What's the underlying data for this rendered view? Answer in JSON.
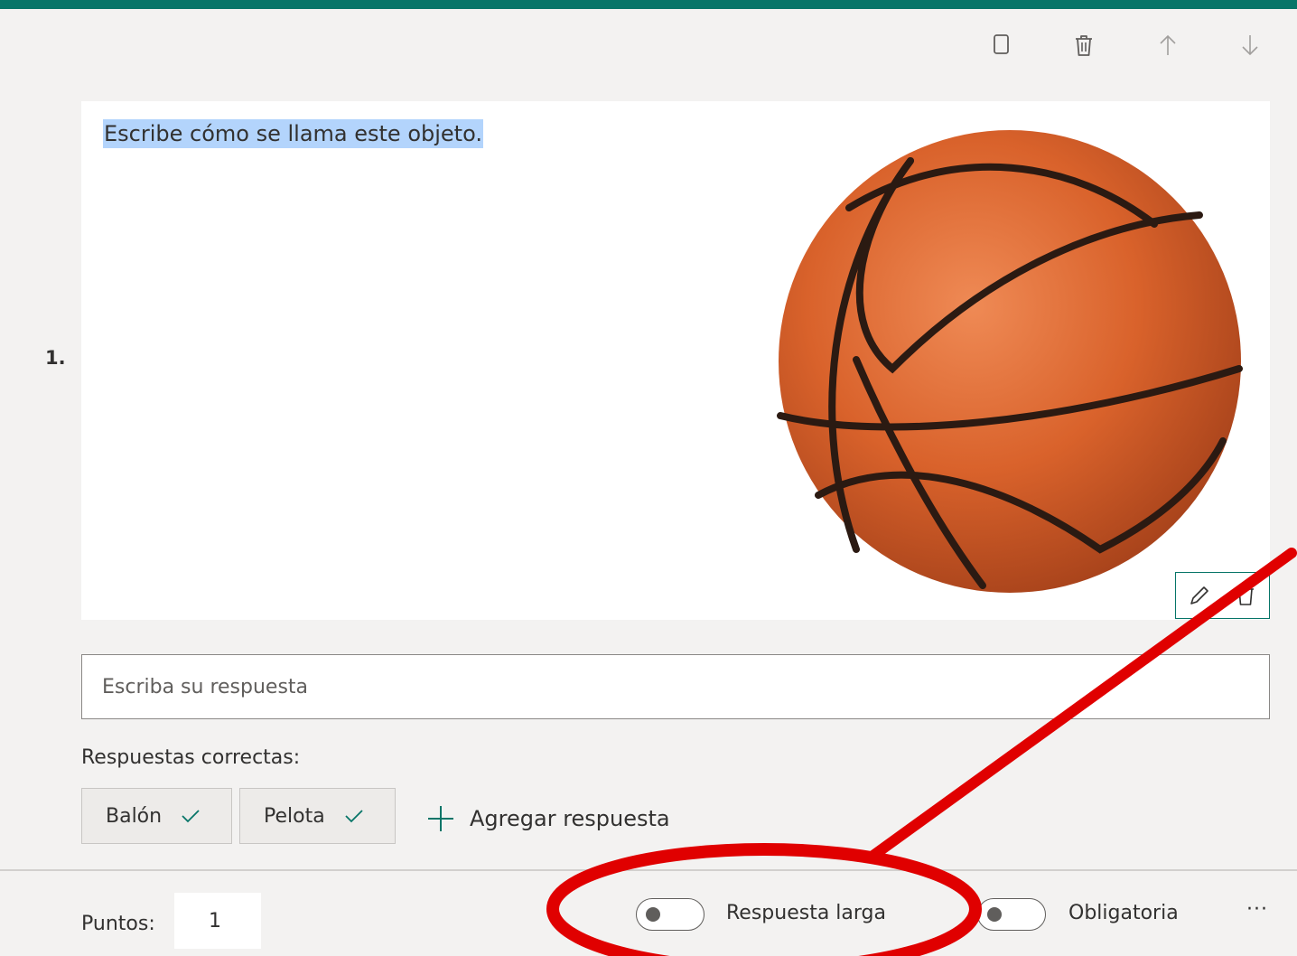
{
  "question": {
    "number": "1.",
    "text": "Escribe cómo se llama este objeto."
  },
  "toolbar": {
    "icons": [
      "copy-icon",
      "delete-icon",
      "move-up-icon",
      "move-down-icon"
    ]
  },
  "image_actions": {
    "icons": [
      "edit-icon",
      "delete-image-icon"
    ]
  },
  "answer": {
    "placeholder": "Escriba su respuesta"
  },
  "correct_answers": {
    "label": "Respuestas correctas:",
    "items": [
      "Balón",
      "Pelota"
    ],
    "add_label": "Agregar respuesta"
  },
  "footer": {
    "points_label": "Puntos:",
    "points_value": "1",
    "long_answer_label": "Respuesta larga",
    "long_answer_on": false,
    "required_label": "Obligatoria",
    "required_on": false,
    "more_label": "···"
  },
  "colors": {
    "accent": "#077568",
    "highlight": "#b3d4fc",
    "annotation": "#e00000",
    "ball": "#d9622b"
  }
}
